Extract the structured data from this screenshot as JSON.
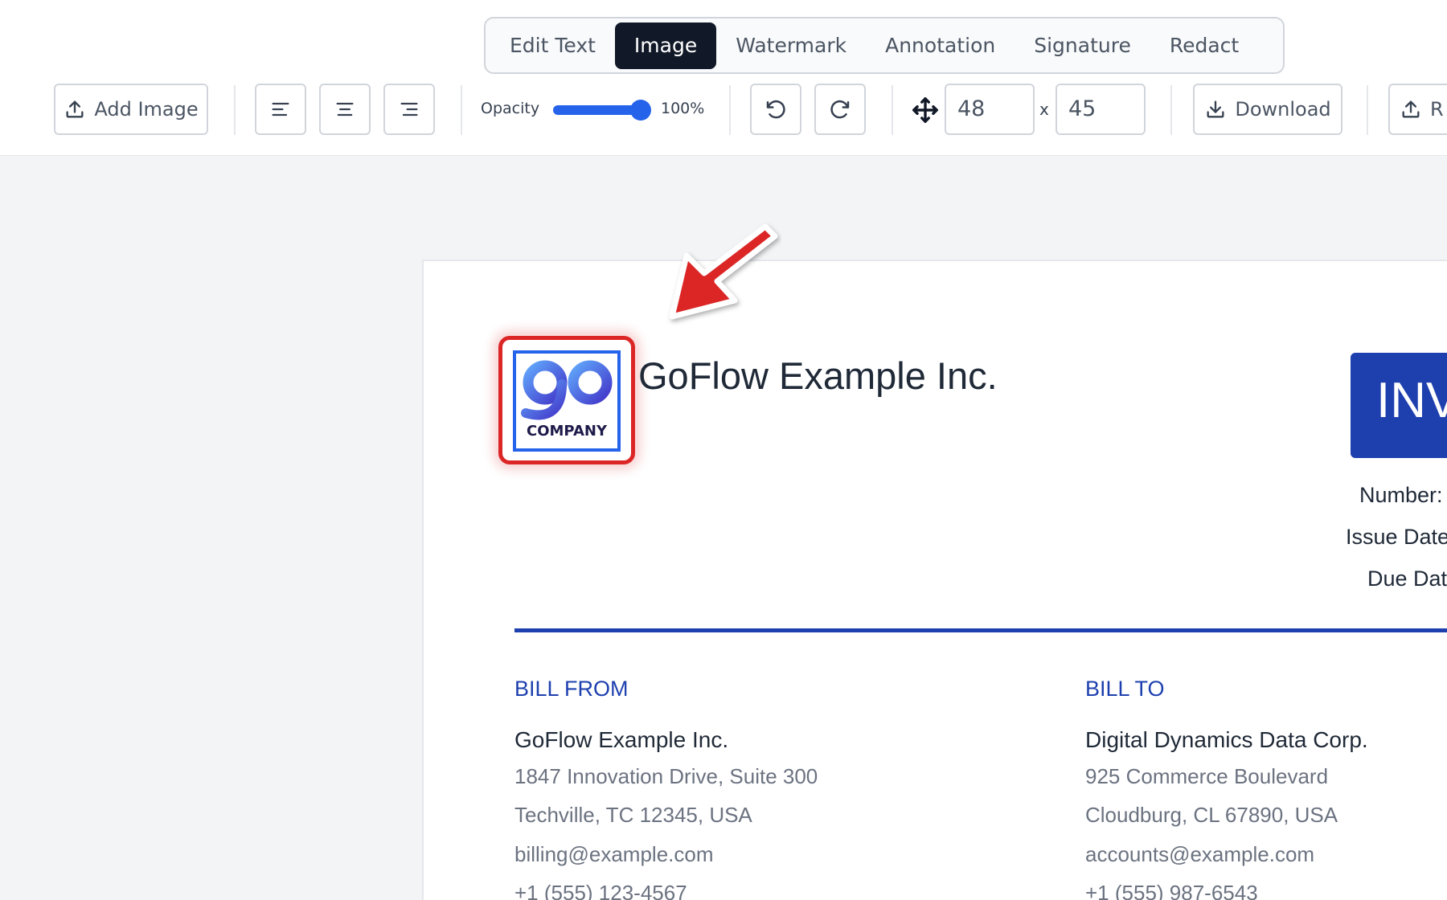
{
  "tabs": [
    "Edit Text",
    "Image",
    "Watermark",
    "Annotation",
    "Signature",
    "Redact"
  ],
  "active_tab": "Image",
  "toolbar": {
    "add_image_label": "Add Image",
    "align_icons": [
      "align-left-icon",
      "align-center-icon",
      "align-right-icon"
    ],
    "opacity_label": "Opacity",
    "opacity_value_text": "100%",
    "opacity_fraction": 1.0,
    "width_value": "48",
    "times_symbol": "x",
    "height_value": "45",
    "download_label": "Download",
    "replace_label_visible": "R"
  },
  "document": {
    "logo_word": "COMPANY",
    "company_title": "GoFlow Example Inc.",
    "invoice_badge_visible": "INV",
    "meta_labels": [
      "Number:",
      "Issue Date",
      "Due Dat"
    ],
    "bill_from": {
      "label": "BILL FROM",
      "name": "GoFlow Example Inc.",
      "address1": "1847 Innovation Drive, Suite 300",
      "address2": "Techville, TC 12345, USA",
      "email": "billing@example.com",
      "phone": "+1 (555) 123-4567"
    },
    "bill_to": {
      "label": "BILL TO",
      "name": "Digital Dynamics Data Corp.",
      "address1": "925 Commerce Boulevard",
      "address2": "Cloudburg, CL 67890, USA",
      "email": "accounts@example.com",
      "phone": "+1 (555) 987-6543"
    }
  },
  "colors": {
    "accent": "#2563eb",
    "brand_blue": "#1e40af",
    "selection_red": "#dc2626",
    "active_tab_bg": "#111827"
  }
}
